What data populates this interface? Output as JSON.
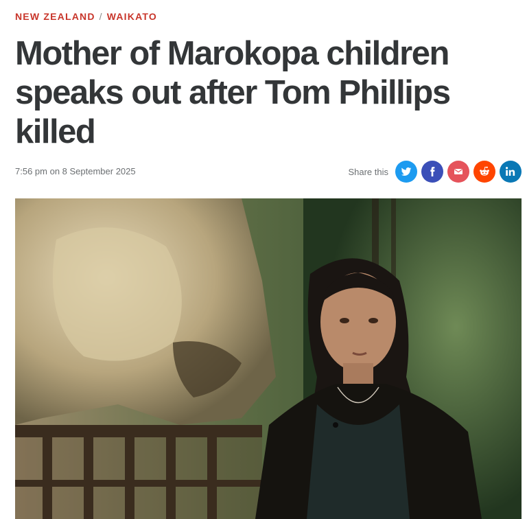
{
  "breadcrumb": {
    "section": "NEW ZEALAND",
    "separator": "/",
    "subsection": "WAIKATO"
  },
  "article": {
    "title": "Mother of Marokopa children speaks out after Tom Phillips killed",
    "dateline": "7:56 pm on 8 September 2025"
  },
  "share": {
    "label": "Share this",
    "buttons": [
      {
        "icon": "twitter-icon",
        "color": "#1d9bf0"
      },
      {
        "icon": "facebook-icon",
        "color": "#3b4fb8"
      },
      {
        "icon": "email-icon",
        "color": "#e5535b"
      },
      {
        "icon": "reddit-icon",
        "color": "#ff4500"
      },
      {
        "icon": "linkedin-icon",
        "color": "#0a78b5"
      }
    ]
  },
  "hero_image": {
    "description_icon": "photo-woman-forest-icon"
  }
}
